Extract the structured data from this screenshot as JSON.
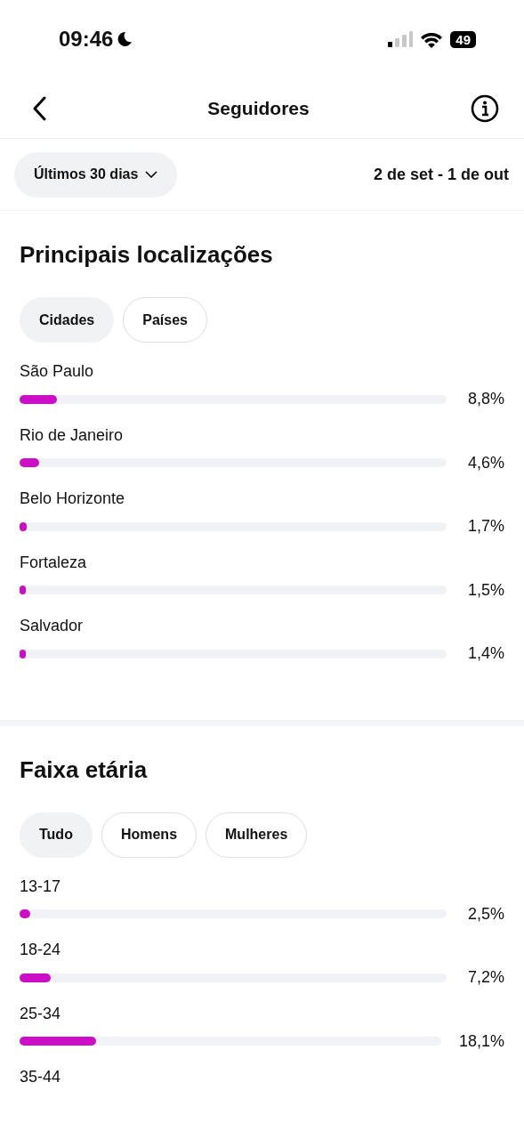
{
  "status_bar": {
    "time": "09:46",
    "battery": "49"
  },
  "header": {
    "title": "Seguidores"
  },
  "filter": {
    "period": "Últimos 30 dias",
    "range": "2 de set - 1 de out"
  },
  "sections": [
    {
      "title": "Principais localizações",
      "chips": [
        {
          "label": "Cidades",
          "selected": true
        },
        {
          "label": "Países",
          "selected": false
        }
      ],
      "rows": [
        {
          "label": "São Paulo",
          "level": 0.088,
          "value": "8,8%"
        },
        {
          "label": "Rio de Janeiro",
          "level": 0.046,
          "value": "4,6%"
        },
        {
          "label": "Belo Horizonte",
          "level": 0.017,
          "value": "1,7%"
        },
        {
          "label": "Fortaleza",
          "level": 0.015,
          "value": "1,5%"
        },
        {
          "label": "Salvador",
          "level": 0.014,
          "value": "1,4%"
        }
      ]
    },
    {
      "title": "Faixa etária",
      "chips": [
        {
          "label": "Tudo",
          "selected": true
        },
        {
          "label": "Homens",
          "selected": false
        },
        {
          "label": "Mulheres",
          "selected": false
        }
      ],
      "rows": [
        {
          "label": "13-17",
          "level": 0.025,
          "value": "2,5%"
        },
        {
          "label": "18-24",
          "level": 0.072,
          "value": "7,2%"
        },
        {
          "label": "25-34",
          "level": 0.181,
          "value": "18,1%"
        },
        {
          "label": "35-44"
        }
      ]
    }
  ]
}
